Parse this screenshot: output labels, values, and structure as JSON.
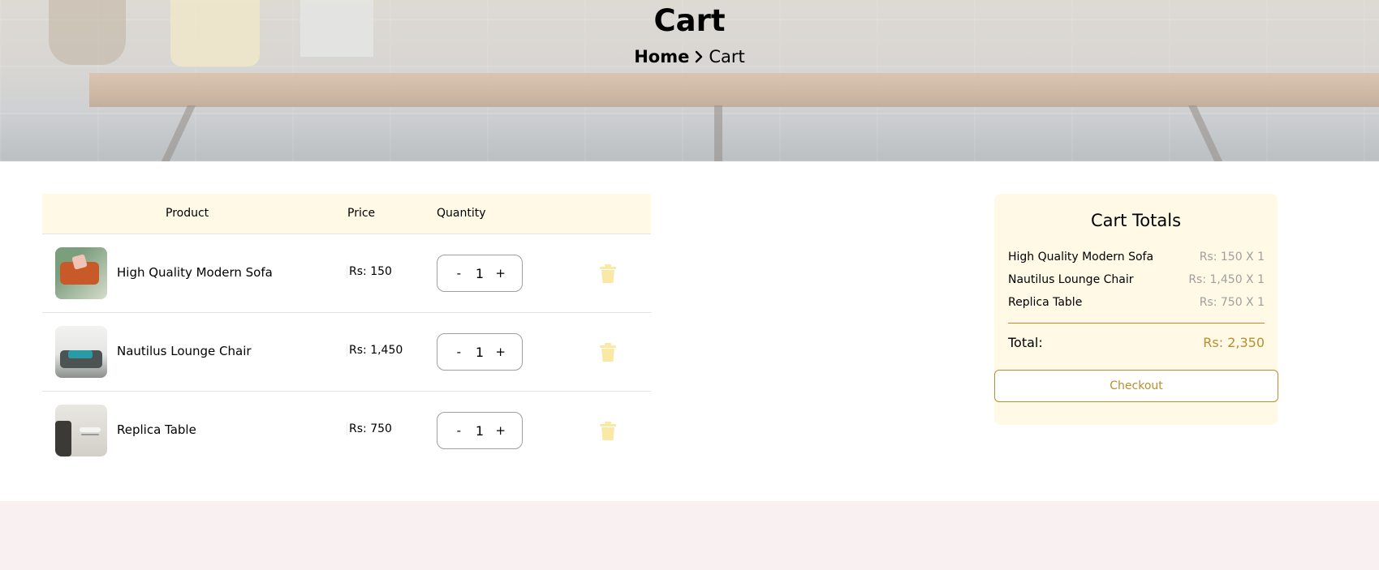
{
  "hero": {
    "title": "Cart",
    "breadcrumb": {
      "home": "Home",
      "separator": "›",
      "current": "Cart"
    }
  },
  "table": {
    "headers": {
      "product": "Product",
      "price": "Price",
      "quantity": "Quantity"
    },
    "rows": [
      {
        "name": "High Quality Modern Sofa",
        "price": "Rs: 150",
        "qty": "1",
        "minus": "-",
        "plus": "+"
      },
      {
        "name": "Nautilus Lounge Chair",
        "price": "Rs: 1,450",
        "qty": "1",
        "minus": "-",
        "plus": "+"
      },
      {
        "name": "Replica Table",
        "price": "Rs: 750",
        "qty": "1",
        "minus": "-",
        "plus": "+"
      }
    ]
  },
  "totals": {
    "title": "Cart Totals",
    "lines": [
      {
        "name": "High Quality Modern Sofa",
        "value": "Rs: 150 X 1"
      },
      {
        "name": "Nautilus Lounge Chair",
        "value": "Rs: 1,450 X 1"
      },
      {
        "name": "Replica Table",
        "value": "Rs: 750 X 1"
      }
    ],
    "total_label": "Total:",
    "total_value": "Rs: 2,350",
    "checkout_label": "Checkout"
  },
  "colors": {
    "accent": "#b88e2f",
    "header_bg": "#fff9e5",
    "trash_icon": "#f9e9a5",
    "bottom_band": "#f9f1f1"
  },
  "icons": {
    "breadcrumb_separator": "chevron-right-icon",
    "delete": "trash-icon"
  },
  "bottom": {
    "fragment": "·"
  }
}
